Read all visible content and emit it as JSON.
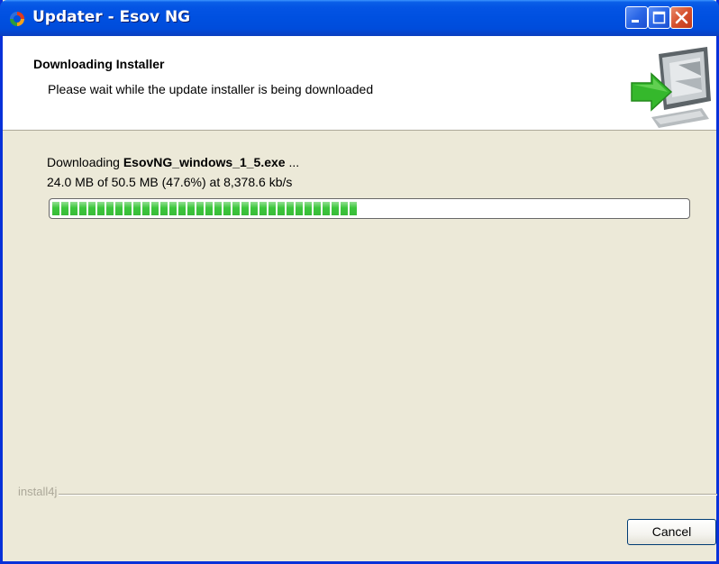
{
  "window": {
    "title": "Updater - Esov NG"
  },
  "header": {
    "title": "Downloading Installer",
    "subtitle": "Please wait while the update installer is being downloaded",
    "graphic": "computer-download-icon"
  },
  "download": {
    "prefix": "Downloading ",
    "filename": "EsovNG_windows_1_5.exe",
    "suffix": " ...",
    "progress_text": "24.0 MB of 50.5 MB (47.6%) at 8,378.6 kb/s",
    "progress_fraction": 0.476
  },
  "footer": {
    "brand": "install4j",
    "cancel_label": "Cancel"
  },
  "colors": {
    "title_bar": "#0054e3",
    "progress": "#3cc63c",
    "dialog_bg": "#ece9d8",
    "close_button": "#d6502c"
  }
}
